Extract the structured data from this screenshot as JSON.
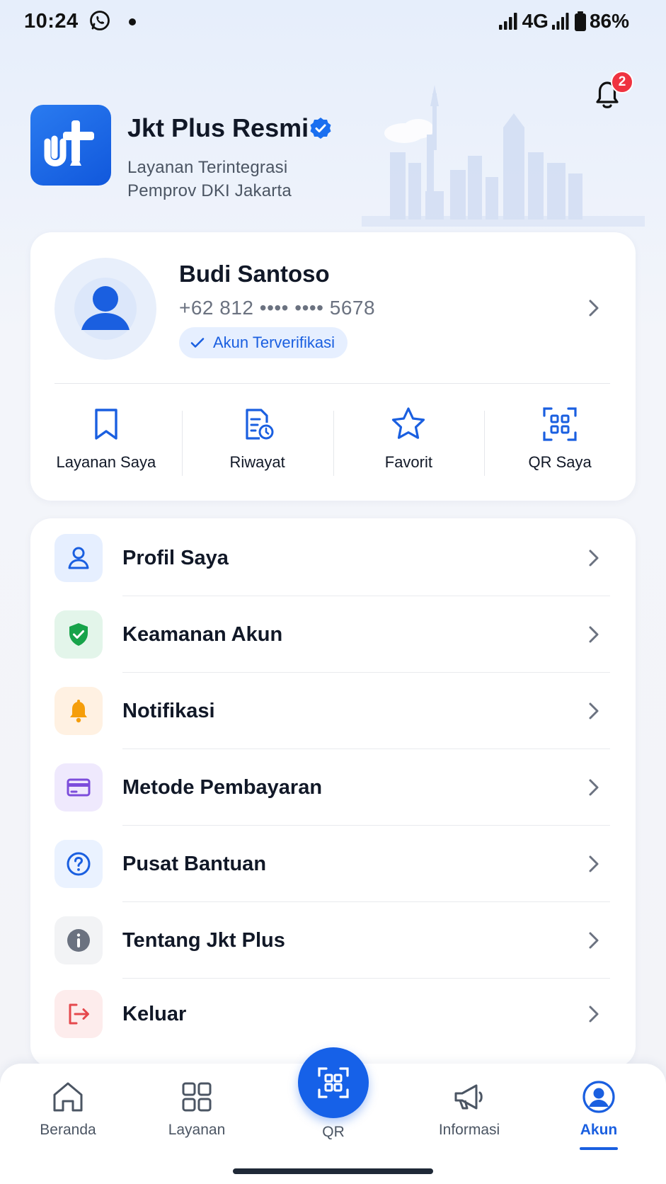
{
  "status_bar": {
    "time": "10:24",
    "network": "4G",
    "battery": "86%",
    "icons": [
      "whatsapp-icon",
      "signal-icon",
      "battery-icon"
    ]
  },
  "header": {
    "app_name": "Jkt Plus Resmi",
    "subtitle_line1": "Layanan Terintegrasi",
    "subtitle_line2": "Pemprov DKI Jakarta",
    "notification_count": "2",
    "icons": [
      "app-logo",
      "verified-icon",
      "bell-icon",
      "jakarta-skyline"
    ]
  },
  "profile": {
    "name": "Budi Santoso",
    "phone": "+62 812 •••• •••• 5678",
    "status": "Akun Terverifikasi"
  },
  "quick_actions": [
    {
      "label": "Layanan Saya",
      "icon": "bookmark-icon"
    },
    {
      "label": "Riwayat",
      "icon": "history-document-icon"
    },
    {
      "label": "Favorit",
      "icon": "star-icon"
    },
    {
      "label": "QR Saya",
      "icon": "qr-scan-icon"
    }
  ],
  "menu": [
    {
      "label": "Profil Saya",
      "icon": "user-icon",
      "bg": "#e6efff",
      "color": "#1a5fe0"
    },
    {
      "label": "Keamanan Akun",
      "icon": "shield-check-icon",
      "bg": "#e3f5ea",
      "color": "#17a34a"
    },
    {
      "label": "Notifikasi",
      "icon": "bell-icon",
      "bg": "#fff1e2",
      "color": "#f59e0b"
    },
    {
      "label": "Metode Pembayaran",
      "icon": "credit-card-icon",
      "bg": "#efe9fd",
      "color": "#7c4ddb"
    },
    {
      "label": "Pusat Bantuan",
      "icon": "help-circle-icon",
      "bg": "#eaf2ff",
      "color": "#1a5fe0"
    },
    {
      "label": "Tentang Jkt Plus",
      "icon": "info-icon",
      "bg": "#f2f3f5",
      "color": "#6b7280"
    },
    {
      "label": "Keluar",
      "icon": "logout-icon",
      "bg": "#fdecec",
      "color": "#e5484d"
    }
  ],
  "bottom_nav": {
    "items": [
      {
        "label": "Beranda",
        "icon": "home-icon"
      },
      {
        "label": "Layanan",
        "icon": "grid-icon"
      },
      {
        "label": "QR",
        "icon": "qr-scan-icon"
      },
      {
        "label": "Informasi",
        "icon": "megaphone-icon"
      },
      {
        "label": "Akun",
        "icon": "user-circle-icon"
      }
    ],
    "active": "Akun"
  },
  "colors": {
    "primary": "#1a5fe0",
    "fab": "#1661e8",
    "badge": "#ef3340"
  }
}
